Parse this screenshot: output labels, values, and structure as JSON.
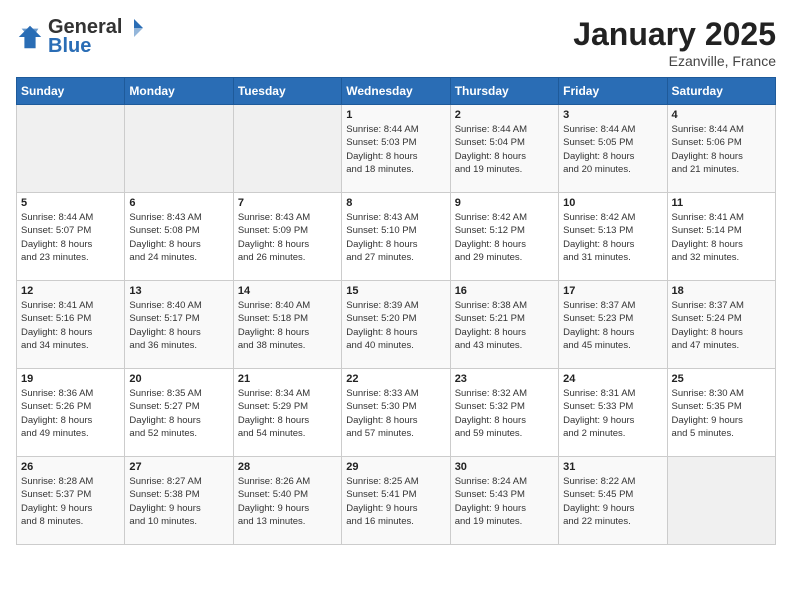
{
  "logo": {
    "general": "General",
    "blue": "Blue"
  },
  "title": "January 2025",
  "subtitle": "Ezanville, France",
  "days_of_week": [
    "Sunday",
    "Monday",
    "Tuesday",
    "Wednesday",
    "Thursday",
    "Friday",
    "Saturday"
  ],
  "weeks": [
    [
      {
        "day": "",
        "info": ""
      },
      {
        "day": "",
        "info": ""
      },
      {
        "day": "",
        "info": ""
      },
      {
        "day": "1",
        "info": "Sunrise: 8:44 AM\nSunset: 5:03 PM\nDaylight: 8 hours\nand 18 minutes."
      },
      {
        "day": "2",
        "info": "Sunrise: 8:44 AM\nSunset: 5:04 PM\nDaylight: 8 hours\nand 19 minutes."
      },
      {
        "day": "3",
        "info": "Sunrise: 8:44 AM\nSunset: 5:05 PM\nDaylight: 8 hours\nand 20 minutes."
      },
      {
        "day": "4",
        "info": "Sunrise: 8:44 AM\nSunset: 5:06 PM\nDaylight: 8 hours\nand 21 minutes."
      }
    ],
    [
      {
        "day": "5",
        "info": "Sunrise: 8:44 AM\nSunset: 5:07 PM\nDaylight: 8 hours\nand 23 minutes."
      },
      {
        "day": "6",
        "info": "Sunrise: 8:43 AM\nSunset: 5:08 PM\nDaylight: 8 hours\nand 24 minutes."
      },
      {
        "day": "7",
        "info": "Sunrise: 8:43 AM\nSunset: 5:09 PM\nDaylight: 8 hours\nand 26 minutes."
      },
      {
        "day": "8",
        "info": "Sunrise: 8:43 AM\nSunset: 5:10 PM\nDaylight: 8 hours\nand 27 minutes."
      },
      {
        "day": "9",
        "info": "Sunrise: 8:42 AM\nSunset: 5:12 PM\nDaylight: 8 hours\nand 29 minutes."
      },
      {
        "day": "10",
        "info": "Sunrise: 8:42 AM\nSunset: 5:13 PM\nDaylight: 8 hours\nand 31 minutes."
      },
      {
        "day": "11",
        "info": "Sunrise: 8:41 AM\nSunset: 5:14 PM\nDaylight: 8 hours\nand 32 minutes."
      }
    ],
    [
      {
        "day": "12",
        "info": "Sunrise: 8:41 AM\nSunset: 5:16 PM\nDaylight: 8 hours\nand 34 minutes."
      },
      {
        "day": "13",
        "info": "Sunrise: 8:40 AM\nSunset: 5:17 PM\nDaylight: 8 hours\nand 36 minutes."
      },
      {
        "day": "14",
        "info": "Sunrise: 8:40 AM\nSunset: 5:18 PM\nDaylight: 8 hours\nand 38 minutes."
      },
      {
        "day": "15",
        "info": "Sunrise: 8:39 AM\nSunset: 5:20 PM\nDaylight: 8 hours\nand 40 minutes."
      },
      {
        "day": "16",
        "info": "Sunrise: 8:38 AM\nSunset: 5:21 PM\nDaylight: 8 hours\nand 43 minutes."
      },
      {
        "day": "17",
        "info": "Sunrise: 8:37 AM\nSunset: 5:23 PM\nDaylight: 8 hours\nand 45 minutes."
      },
      {
        "day": "18",
        "info": "Sunrise: 8:37 AM\nSunset: 5:24 PM\nDaylight: 8 hours\nand 47 minutes."
      }
    ],
    [
      {
        "day": "19",
        "info": "Sunrise: 8:36 AM\nSunset: 5:26 PM\nDaylight: 8 hours\nand 49 minutes."
      },
      {
        "day": "20",
        "info": "Sunrise: 8:35 AM\nSunset: 5:27 PM\nDaylight: 8 hours\nand 52 minutes."
      },
      {
        "day": "21",
        "info": "Sunrise: 8:34 AM\nSunset: 5:29 PM\nDaylight: 8 hours\nand 54 minutes."
      },
      {
        "day": "22",
        "info": "Sunrise: 8:33 AM\nSunset: 5:30 PM\nDaylight: 8 hours\nand 57 minutes."
      },
      {
        "day": "23",
        "info": "Sunrise: 8:32 AM\nSunset: 5:32 PM\nDaylight: 8 hours\nand 59 minutes."
      },
      {
        "day": "24",
        "info": "Sunrise: 8:31 AM\nSunset: 5:33 PM\nDaylight: 9 hours\nand 2 minutes."
      },
      {
        "day": "25",
        "info": "Sunrise: 8:30 AM\nSunset: 5:35 PM\nDaylight: 9 hours\nand 5 minutes."
      }
    ],
    [
      {
        "day": "26",
        "info": "Sunrise: 8:28 AM\nSunset: 5:37 PM\nDaylight: 9 hours\nand 8 minutes."
      },
      {
        "day": "27",
        "info": "Sunrise: 8:27 AM\nSunset: 5:38 PM\nDaylight: 9 hours\nand 10 minutes."
      },
      {
        "day": "28",
        "info": "Sunrise: 8:26 AM\nSunset: 5:40 PM\nDaylight: 9 hours\nand 13 minutes."
      },
      {
        "day": "29",
        "info": "Sunrise: 8:25 AM\nSunset: 5:41 PM\nDaylight: 9 hours\nand 16 minutes."
      },
      {
        "day": "30",
        "info": "Sunrise: 8:24 AM\nSunset: 5:43 PM\nDaylight: 9 hours\nand 19 minutes."
      },
      {
        "day": "31",
        "info": "Sunrise: 8:22 AM\nSunset: 5:45 PM\nDaylight: 9 hours\nand 22 minutes."
      },
      {
        "day": "",
        "info": ""
      }
    ]
  ]
}
